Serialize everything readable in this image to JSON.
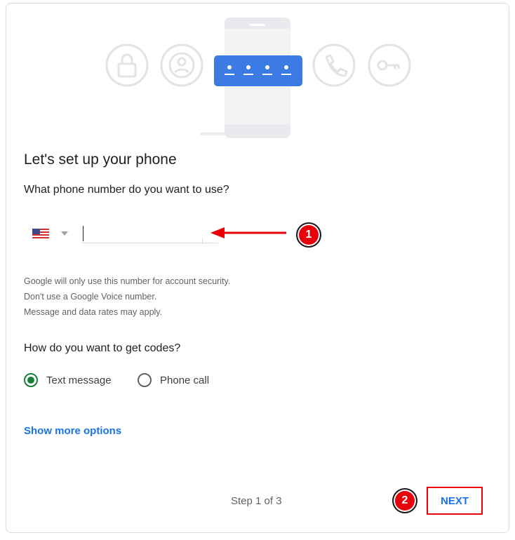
{
  "header": {
    "title": "Let's set up your phone"
  },
  "phone": {
    "question": "What phone number do you want to use?",
    "country": "US",
    "value": "",
    "placeholder": ""
  },
  "info_lines": [
    "Google will only use this number for account security.",
    "Don't use a Google Voice number.",
    "Message and data rates may apply."
  ],
  "codes": {
    "question": "How do you want to get codes?",
    "options": [
      {
        "label": "Text message",
        "selected": true
      },
      {
        "label": "Phone call",
        "selected": false
      }
    ]
  },
  "more_options": "Show more options",
  "footer": {
    "step": "Step 1 of 3",
    "next_label": "NEXT"
  },
  "annotations": {
    "badge1": "1",
    "badge2": "2"
  },
  "colors": {
    "accent": "#1a73e8",
    "radio_selected": "#188038",
    "annotation_red": "#e8000b",
    "illustration_blue": "#3c7ae4"
  },
  "icons": [
    "lock-icon",
    "account-circle-icon",
    "password-dots-icon",
    "phone-icon",
    "key-icon",
    "us-flag-icon",
    "chevron-down-icon"
  ]
}
